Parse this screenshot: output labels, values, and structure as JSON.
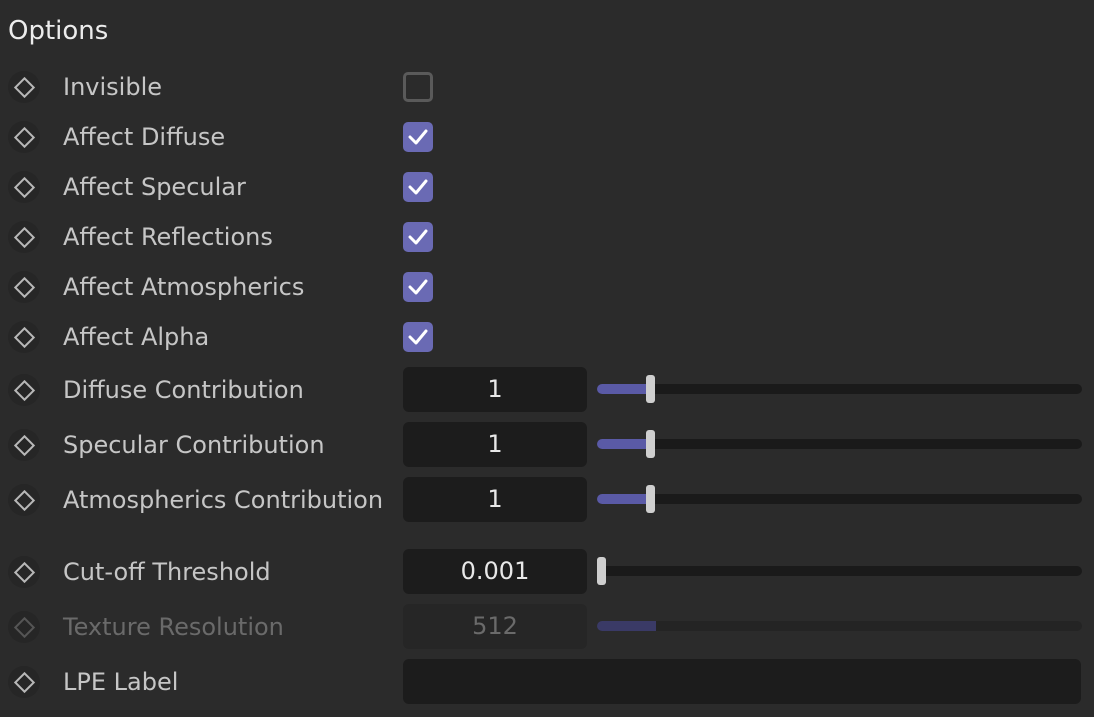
{
  "section": {
    "title": "Options"
  },
  "rows": [
    {
      "label": "Invisible",
      "type": "checkbox",
      "checked": false
    },
    {
      "label": "Affect Diffuse",
      "type": "checkbox",
      "checked": true
    },
    {
      "label": "Affect Specular",
      "type": "checkbox",
      "checked": true
    },
    {
      "label": "Affect Reflections",
      "type": "checkbox",
      "checked": true
    },
    {
      "label": "Affect Atmospherics",
      "type": "checkbox",
      "checked": true
    },
    {
      "label": "Affect Alpha",
      "type": "checkbox",
      "checked": true
    },
    {
      "label": "Diffuse Contribution",
      "type": "slider",
      "value": "1",
      "slider_fraction": 0.1
    },
    {
      "label": "Specular Contribution",
      "type": "slider",
      "value": "1",
      "slider_fraction": 0.1
    },
    {
      "label": "Atmospherics Contribution",
      "type": "slider",
      "value": "1",
      "slider_fraction": 0.1
    },
    {
      "label": "Cut-off Threshold",
      "type": "slider",
      "value": "0.001",
      "slider_fraction": 0.0
    },
    {
      "label": "Texture Resolution",
      "type": "slider",
      "value": "512",
      "slider_fraction": 0.06,
      "disabled": true
    },
    {
      "label": "LPE Label",
      "type": "text",
      "value": ""
    }
  ],
  "colors": {
    "accent": "#6a6ab4",
    "slider_fill": "#5a5aa6",
    "background": "#2b2b2b",
    "field": "#1c1c1c"
  },
  "icons": {
    "keyframe": "keyframe-diamond-icon",
    "check": "checkmark-icon"
  }
}
